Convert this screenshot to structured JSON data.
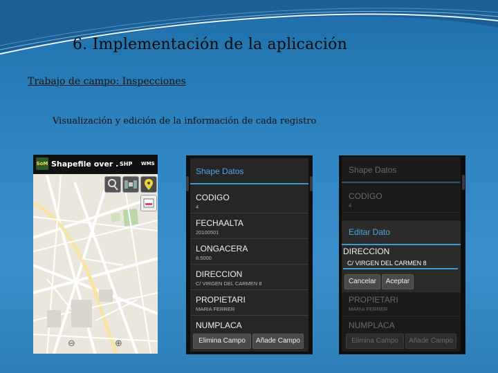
{
  "slide": {
    "title": "6. Implementación de la aplicación",
    "subtitle": "Trabajo de campo: Inspecciones",
    "caption": "Visualización y edición de la información de cada registro"
  },
  "map_screen": {
    "app_title": "Shapefile over .",
    "logo_text": "SoM",
    "shp_label": "SHP",
    "wms_label": "WMS",
    "zoom_out": "⊖",
    "zoom_in": "⊕"
  },
  "data_screen": {
    "dialog_title": "Shape Datos",
    "fields": [
      {
        "name": "CODIGO",
        "value": "4"
      },
      {
        "name": "FECHAALTA",
        "value": "20100501"
      },
      {
        "name": "LONGACERA",
        "value": "8.5000"
      },
      {
        "name": "DIRECCION",
        "value": "C/ VIRGEN DEL CARMEN 8"
      },
      {
        "name": "PROPIETARI",
        "value": "MARIA FERRER"
      },
      {
        "name": "NUMPLACA",
        "value": ""
      }
    ],
    "delete_button": "Elimina Campo",
    "add_button": "Añade Campo"
  },
  "edit_screen": {
    "dialog_title": "Shape Datos",
    "bg_field_1_name": "CODIGO",
    "bg_field_1_value": "4",
    "edit_title": "Editar Dato",
    "edit_label": "DIRECCION",
    "edit_value": "C/ VIRGEN DEL CARMEN 8",
    "cancel_button": "Cancelar",
    "accept_button": "Aceptar",
    "bg_field_2_name": "PROPIETARI",
    "bg_field_2_value": "MARIA FERRER",
    "bg_field_3_name": "NUMPLACA",
    "delete_button": "Elimina Campo",
    "add_button": "Añade Campo"
  }
}
